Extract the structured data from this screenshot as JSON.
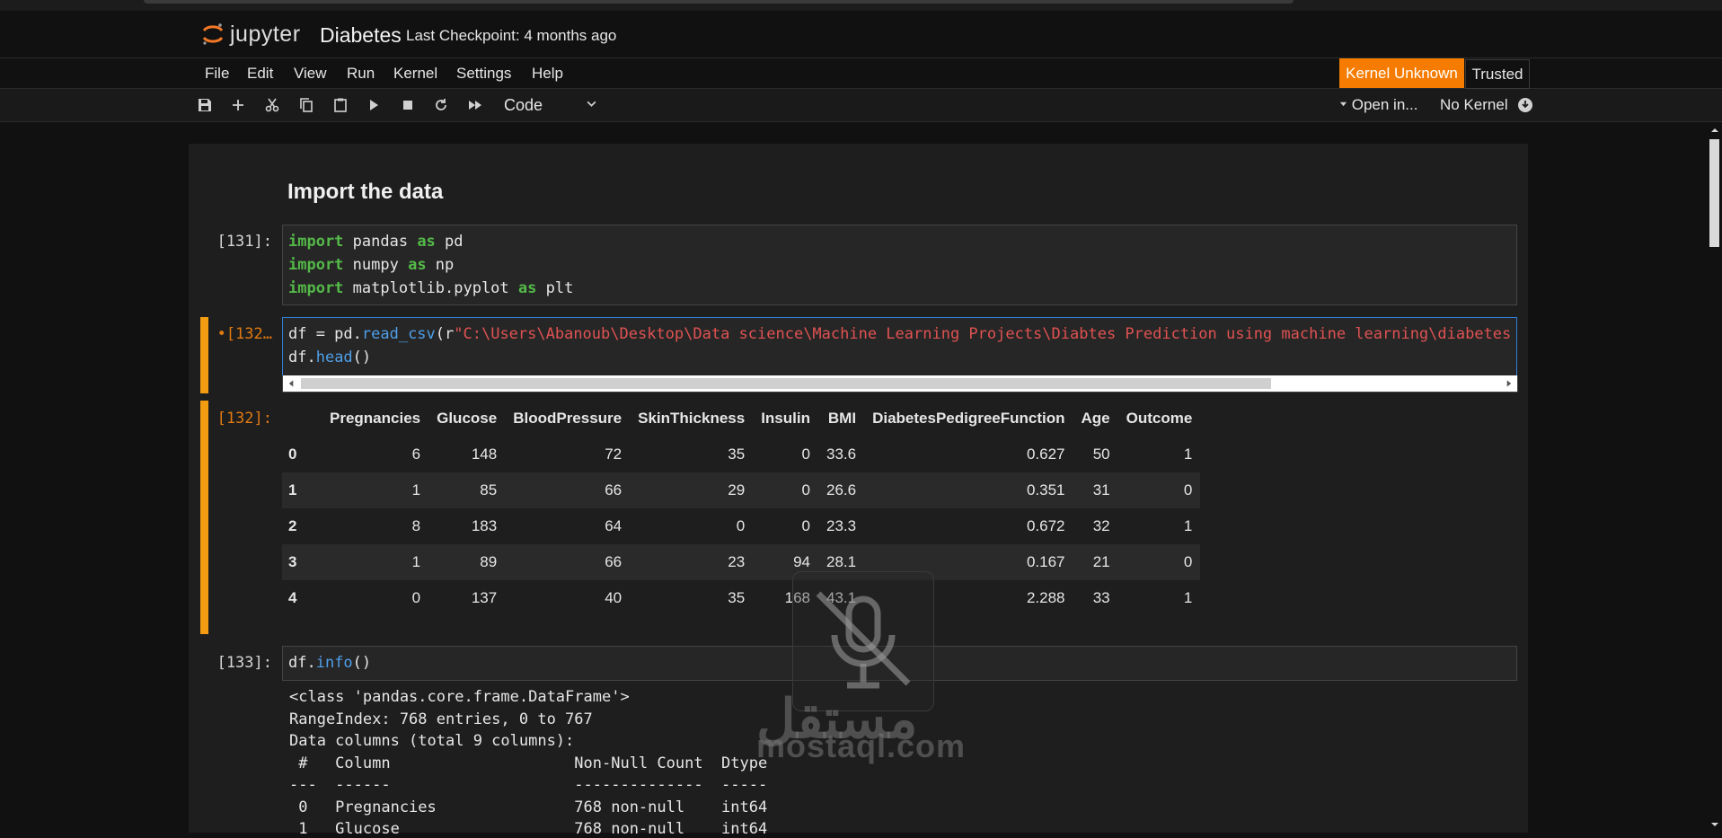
{
  "header": {
    "app_name": "jupyter",
    "notebook_title": "Diabetes",
    "checkpoint": "Last Checkpoint: 4 months ago"
  },
  "menu": [
    "File",
    "Edit",
    "View",
    "Run",
    "Kernel",
    "Settings",
    "Help"
  ],
  "kernel": {
    "status": "Kernel Unknown",
    "trusted": "Trusted",
    "open_in": "Open in...",
    "no_kernel": "No Kernel"
  },
  "toolbar": {
    "icons": [
      "save-icon",
      "add-cell-icon",
      "cut-icon",
      "copy-icon",
      "paste-icon",
      "run-icon",
      "stop-icon",
      "restart-icon",
      "fast-forward-icon"
    ],
    "cell_type": "Code"
  },
  "colors": {
    "accent_orange": "#f57c00",
    "keyword_green": "#54b948",
    "function_blue": "#4f9fe8",
    "string_red": "#e05252"
  },
  "cells": {
    "markdown_heading": "Import the data",
    "cell1": {
      "prompt": "[131]:",
      "lines": [
        {
          "kw": "import",
          "rest1": " pandas ",
          "kw2": "as",
          "rest2": " pd"
        },
        {
          "kw": "import",
          "rest1": " numpy ",
          "kw2": "as",
          "rest2": " np"
        },
        {
          "kw": "import",
          "rest1": " matplotlib.pyplot ",
          "kw2": "as",
          "rest2": " plt"
        }
      ]
    },
    "cell2": {
      "prompt": "•[132…",
      "line1_a": "df = pd.",
      "line1_fn": "read_csv",
      "line1_b": "(r",
      "line1_str": "\"C:\\Users\\Abanoub\\Desktop\\Data science\\Machine Learning Projects\\Diabtes Prediction using machine learning\\diabetes",
      "line2_a": "df.",
      "line2_fn": "head",
      "line2_b": "()"
    },
    "output2": {
      "prompt": "[132]:",
      "columns": [
        "",
        "Pregnancies",
        "Glucose",
        "BloodPressure",
        "SkinThickness",
        "Insulin",
        "BMI",
        "DiabetesPedigreeFunction",
        "Age",
        "Outcome"
      ],
      "rows": [
        [
          "0",
          "6",
          "148",
          "72",
          "35",
          "0",
          "33.6",
          "0.627",
          "50",
          "1"
        ],
        [
          "1",
          "1",
          "85",
          "66",
          "29",
          "0",
          "26.6",
          "0.351",
          "31",
          "0"
        ],
        [
          "2",
          "8",
          "183",
          "64",
          "0",
          "0",
          "23.3",
          "0.672",
          "32",
          "1"
        ],
        [
          "3",
          "1",
          "89",
          "66",
          "23",
          "94",
          "28.1",
          "0.167",
          "21",
          "0"
        ],
        [
          "4",
          "0",
          "137",
          "40",
          "35",
          "168",
          "43.1",
          "2.288",
          "33",
          "1"
        ]
      ]
    },
    "cell3": {
      "prompt": "[133]:",
      "code_a": "df.",
      "code_fn": "info",
      "code_b": "()",
      "output_lines": [
        "<class 'pandas.core.frame.DataFrame'>",
        "RangeIndex: 768 entries, 0 to 767",
        "Data columns (total 9 columns):",
        " #   Column                    Non-Null Count  Dtype",
        "---  ------                    --------------  -----",
        " 0   Pregnancies               768 non-null    int64",
        " 1   Glucose                   768 non-null    int64"
      ]
    }
  },
  "watermark": {
    "latin": "mostaql.com",
    "arabic": "مستقل",
    "icon": "muted-microphone-icon"
  }
}
